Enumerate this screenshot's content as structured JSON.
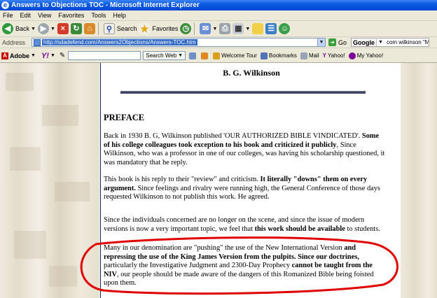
{
  "window": {
    "title": "Answers to Objections TOC - Microsoft Internet Explorer"
  },
  "menu": {
    "items": [
      "File",
      "Edit",
      "View",
      "Favorites",
      "Tools",
      "Help"
    ]
  },
  "toolbar": {
    "back_label": "Back",
    "search_label": "Search",
    "favorites_label": "Favorites"
  },
  "address": {
    "label": "Address",
    "url": "http://sdadefend.com/Answers2Objections/Answers-TOC.htm",
    "go_label": "Go",
    "google_label": "Google",
    "google_query": "com wilkinson \"Many"
  },
  "links": {
    "adobe_label": "Adobe",
    "yahoo_mark": "Y!",
    "search_web_label": "Search Web",
    "welcome_tour": "Welcome Tour",
    "bookmarks": "Bookmarks",
    "mail": "Mail",
    "yahoo": "Yahoo!",
    "my_yahoo": "My Yahoo!"
  },
  "page": {
    "author": "B. G. Wilkinson",
    "heading": "PREFACE",
    "p1": {
      "a": "Back in 1930 B. G, Wilkinson published 'OUR AUTHORIZED BIBLE VINDICATED'.",
      "b": "Some of his college colleagues took exception to his book and criticized it publicly",
      "c": ", Since Wilkinson, who was a professor in one of our colleges, was having his scholarship questioned, it was mandatory that he reply."
    },
    "p2": {
      "a": "This book is his reply to their \"review\" and criticism. ",
      "b": "It literally \"downs\" them on every argument.",
      "c": " Since feelings and rivalry were running high, the General Conference of those days requested Wilkinson to not publish this work. He agreed."
    },
    "p3": {
      "a": "Since the individuals concerned are no longer on the scene, and since the issue of modern versions is now a very important topic, we feel that ",
      "b": "this work should be available",
      "c": " to students."
    },
    "p4": {
      "a": "Many in our denomination are \"pushing\" the use of the New International Version ",
      "b": "and repressing the use of the King James Version from the pulpits. Since our doctrines,",
      "c": " particularly the Investigative Judgment and 2300-Day Prophecy ",
      "d": "cannot be taught from the NIV",
      "e": ", our people should be made aware of the dangers of this Romanized Bible being foisted upon them."
    }
  },
  "colors": {
    "title_bar": "#0a5be0",
    "annotation": "#e00000",
    "page_border": "#1b2a66"
  }
}
